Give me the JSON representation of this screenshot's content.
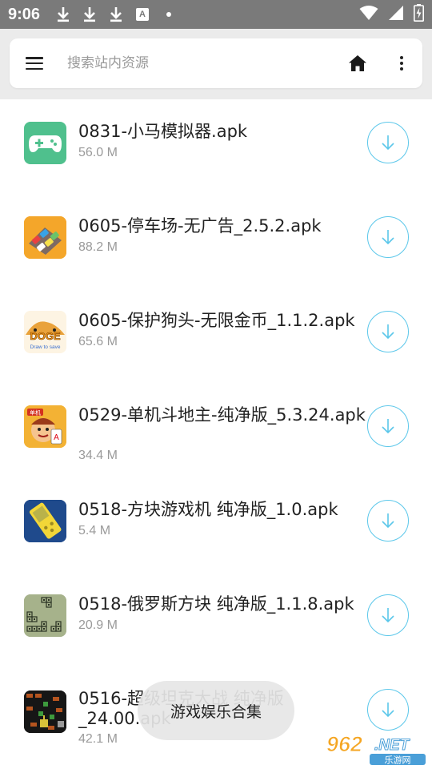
{
  "status_bar": {
    "time": "9:06",
    "left_icons": [
      "download-icon",
      "download-icon",
      "download-icon",
      "a-icon",
      "dot-icon"
    ],
    "a_icon_text": "A",
    "right_icons": [
      "wifi-icon",
      "signal-icon",
      "battery-charging-icon"
    ]
  },
  "search": {
    "placeholder": "搜索站内资源"
  },
  "files": [
    {
      "name": "0831-小马模拟器.apk",
      "size": "56.0 M",
      "icon": "gamepad-icon"
    },
    {
      "name": "0605-停车场-无广告_2.5.2.apk",
      "size": "88.2 M",
      "icon": "parking-game-icon"
    },
    {
      "name": "0605-保护狗头-无限金币_1.1.2.apk",
      "size": "65.6 M",
      "icon": "save-the-doge-icon",
      "icon_text": "DOGE",
      "icon_subtext": "Draw to save"
    },
    {
      "name": "0529-单机斗地主-纯净版_5.3.24.apk",
      "size": "34.4 M",
      "icon": "landlord-cards-icon",
      "icon_text": "单机"
    },
    {
      "name": "0518-方块游戏机 纯净版_1.0.apk",
      "size": "5.4 M",
      "icon": "brick-game-icon"
    },
    {
      "name": "0518-俄罗斯方块 纯净版_1.1.8.apk",
      "size": "20.9 M",
      "icon": "tetris-icon"
    },
    {
      "name": "0516-超级坦克大战 纯净版_24.00.apk",
      "size": "42.1 M",
      "icon": "tank-battle-icon"
    }
  ],
  "toast": {
    "text": "游戏娱乐合集"
  },
  "watermark": {
    "number": "962",
    "suffix": ".NET",
    "subtitle": "乐游网"
  },
  "colors": {
    "status_bar": "#7a7a7a",
    "accent": "#5bc7ea",
    "gamepad": "#4fc08d"
  }
}
